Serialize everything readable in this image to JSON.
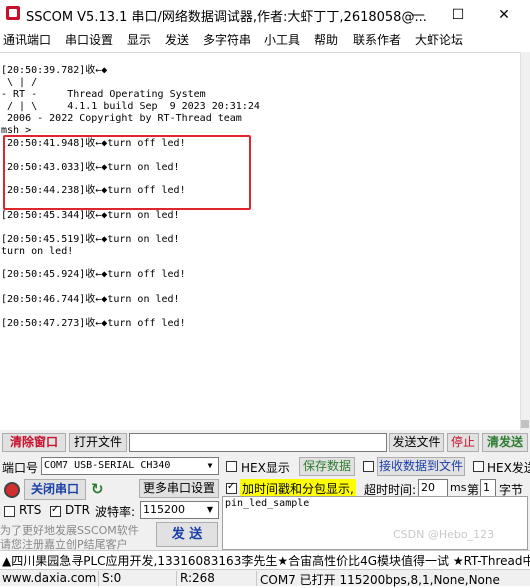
{
  "window": {
    "title": "SSCOM V5.13.1 串口/网络数据调试器,作者:大虾丁丁,2618058@...",
    "minimize": "—",
    "maximize": "☐",
    "close": "✕"
  },
  "menu": [
    "通讯端口",
    "串口设置",
    "显示",
    "发送",
    "多字符串",
    "小工具",
    "帮助",
    "联系作者",
    "大虾论坛"
  ],
  "terminal": {
    "lines": [
      "[20:50:39.782]收←◆",
      " \\ | /",
      "- RT -     Thread Operating System",
      " / | \\     4.1.1 build Sep  9 2023 20:31:24",
      " 2006 - 2022 Copyright by RT-Thread team",
      "msh >",
      "[20:50:41.948]收←◆turn off led!",
      "[20:50:43.033]收←◆turn on led!",
      "[20:50:44.238]收←◆turn off led!",
      "[20:50:45.344]收←◆turn on led!",
      "[20:50:45.519]收←◆turn on led!",
      "turn on led!",
      "[20:50:45.924]收←◆turn off led!",
      "[20:50:46.744]收←◆turn on led!",
      "[20:50:47.273]收←◆turn off led!"
    ]
  },
  "controls": {
    "clear_window": "清除窗口",
    "open_file": "打开文件",
    "file_path": "",
    "send_file": "发送文件",
    "stop": "停止",
    "clear_send": "清发送",
    "port_label": "端口号",
    "port_value": "COM7 USB-SERIAL CH340",
    "hex_display": "HEX显示",
    "save_data": "保存数据",
    "receive_to_file": "接收数据到文件",
    "hex_send": "HEX发送",
    "close_port": "关闭串口",
    "more_settings": "更多串口设置",
    "timestamp_split": "加时间戳和分包显示,",
    "timeout_label": "超时时间:",
    "timeout_value": "20",
    "timeout_unit": "ms",
    "byte_prefix": "第",
    "byte_value": "1",
    "byte_suffix": "字节",
    "rts": "RTS",
    "dtr": "DTR",
    "baud_label": "波特率:",
    "baud_value": "115200",
    "send_text": "pin_led_sample",
    "promo_line1": "为了更好地发展SSCOM软件",
    "promo_line2": "请您注册嘉立创P结尾客户",
    "send": "发  送"
  },
  "ticker": "▲四川果园急寻PLC应用开发,13316083163李先生★合宙高性价比4G模块值得一试 ★RT-Thread中国",
  "status": {
    "website": "www.daxia.com",
    "sent": "S:0",
    "received": "R:268",
    "port_state": "COM7 已打开  115200bps,8,1,None,None"
  },
  "watermark": "CSDN @Hebo_123",
  "colors": {
    "highlight_box": "#e0262a",
    "stop_red": "#c8102e",
    "save_green": "#2e7d32",
    "timestamp_yellow": "#ffff00",
    "power_red": "#d32f2f"
  },
  "icons": {
    "app": "sscom-logo-icon",
    "port_power": "power-icon",
    "refresh": "refresh-icon"
  }
}
